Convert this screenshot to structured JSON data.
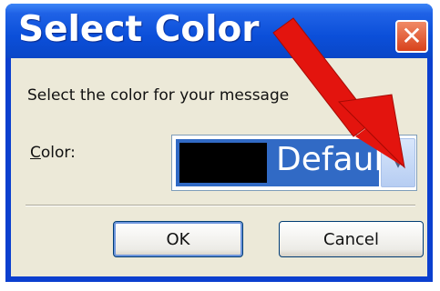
{
  "window": {
    "title": "Select Color",
    "close_glyph": "✕"
  },
  "dialog": {
    "message": "Select the color for your message",
    "color_label_accelerator": "C",
    "color_label_rest": "olor:",
    "combo": {
      "swatch_color": "#000000",
      "selected_text": "Default",
      "dropdown_glyph": "▾"
    },
    "ok_label": "OK",
    "cancel_label": "Cancel"
  },
  "annotation": {
    "arrow_color": "#e3140e",
    "icon": "red-arrow-icon"
  },
  "colors": {
    "titlebar": "#0b4fd9",
    "dialog_bg": "#ece9d8",
    "selection": "#316ac5"
  }
}
